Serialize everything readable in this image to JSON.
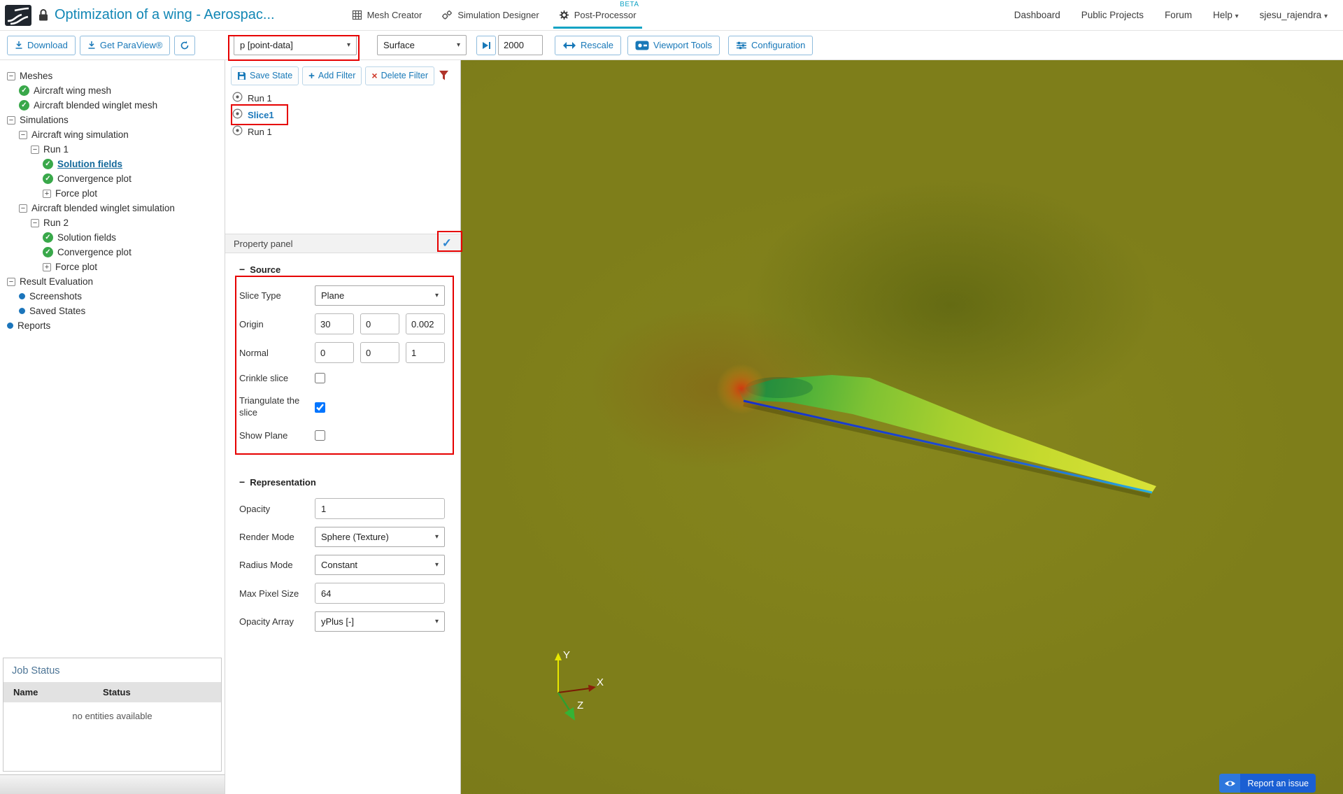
{
  "header": {
    "title": "Optimization of a wing - Aerospac...",
    "tabs": [
      {
        "label": "Mesh Creator"
      },
      {
        "label": "Simulation Designer"
      },
      {
        "label": "Post-Processor",
        "beta": "BETA"
      }
    ],
    "nav": {
      "dashboard": "Dashboard",
      "public_projects": "Public Projects",
      "forum": "Forum",
      "help": "Help",
      "user": "sjesu_rajendra"
    }
  },
  "toolbar": {
    "download": "Download",
    "get_paraview": "Get ParaView®",
    "field_select": "p [point-data]",
    "display_select": "Surface",
    "frame_value": "2000",
    "rescale": "Rescale",
    "viewport_tools": "Viewport Tools",
    "configuration": "Configuration"
  },
  "tree": {
    "items": [
      {
        "label": "Meshes",
        "level": 0,
        "icon": "minus"
      },
      {
        "label": "Aircraft wing mesh",
        "level": 1,
        "icon": "check"
      },
      {
        "label": "Aircraft blended winglet mesh",
        "level": 1,
        "icon": "check"
      },
      {
        "label": "Simulations",
        "level": 0,
        "icon": "minus"
      },
      {
        "label": "Aircraft wing simulation",
        "level": 1,
        "icon": "minus"
      },
      {
        "label": "Run 1",
        "level": 2,
        "icon": "minus"
      },
      {
        "label": "Solution fields",
        "level": 3,
        "icon": "check",
        "active": true
      },
      {
        "label": "Convergence plot",
        "level": 3,
        "icon": "check"
      },
      {
        "label": "Force plot",
        "level": 3,
        "icon": "plus"
      },
      {
        "label": "Aircraft blended winglet simulation",
        "level": 1,
        "icon": "minus"
      },
      {
        "label": "Run 2",
        "level": 2,
        "icon": "minus"
      },
      {
        "label": "Solution fields",
        "level": 3,
        "icon": "check"
      },
      {
        "label": "Convergence plot",
        "level": 3,
        "icon": "check"
      },
      {
        "label": "Force plot",
        "level": 3,
        "icon": "plus"
      },
      {
        "label": "Result Evaluation",
        "level": 0,
        "icon": "minus"
      },
      {
        "label": "Screenshots",
        "level": 1,
        "icon": "dot"
      },
      {
        "label": "Saved States",
        "level": 1,
        "icon": "dot"
      },
      {
        "label": "Reports",
        "level": 0,
        "icon": "dot"
      }
    ]
  },
  "filters": {
    "save_state": "Save State",
    "add_filter": "Add Filter",
    "delete_filter": "Delete Filter",
    "items": [
      {
        "label": "Run 1"
      },
      {
        "label": "Slice1",
        "selected": true
      },
      {
        "label": "Run 1"
      }
    ]
  },
  "properties": {
    "panel_title": "Property panel",
    "source": {
      "title": "Source",
      "slice_type_label": "Slice Type",
      "slice_type_value": "Plane",
      "origin_label": "Origin",
      "origin_values": [
        "30",
        "0",
        "0.002"
      ],
      "normal_label": "Normal",
      "normal_values": [
        "0",
        "0",
        "1"
      ],
      "crinkle_label": "Crinkle slice",
      "triangulate_label": "Triangulate the slice",
      "triangulate_checked": true,
      "show_plane_label": "Show Plane"
    },
    "representation": {
      "title": "Representation",
      "opacity_label": "Opacity",
      "opacity_value": "1",
      "render_mode_label": "Render Mode",
      "render_mode_value": "Sphere (Texture)",
      "radius_mode_label": "Radius Mode",
      "radius_mode_value": "Constant",
      "max_pixel_label": "Max Pixel Size",
      "max_pixel_value": "64",
      "opacity_array_label": "Opacity Array",
      "opacity_array_value": "yPlus [-]"
    }
  },
  "job_status": {
    "title": "Job Status",
    "name_col": "Name",
    "status_col": "Status",
    "empty": "no entities available"
  },
  "viewport": {
    "axis_x": "X",
    "axis_y": "Y",
    "axis_z": "Z",
    "report_issue": "Report an issue",
    "background_color": "#7a7a17",
    "accent_color": "#1878b8",
    "annotation_color": "#e60000",
    "brand_color": "#12a3c4"
  }
}
